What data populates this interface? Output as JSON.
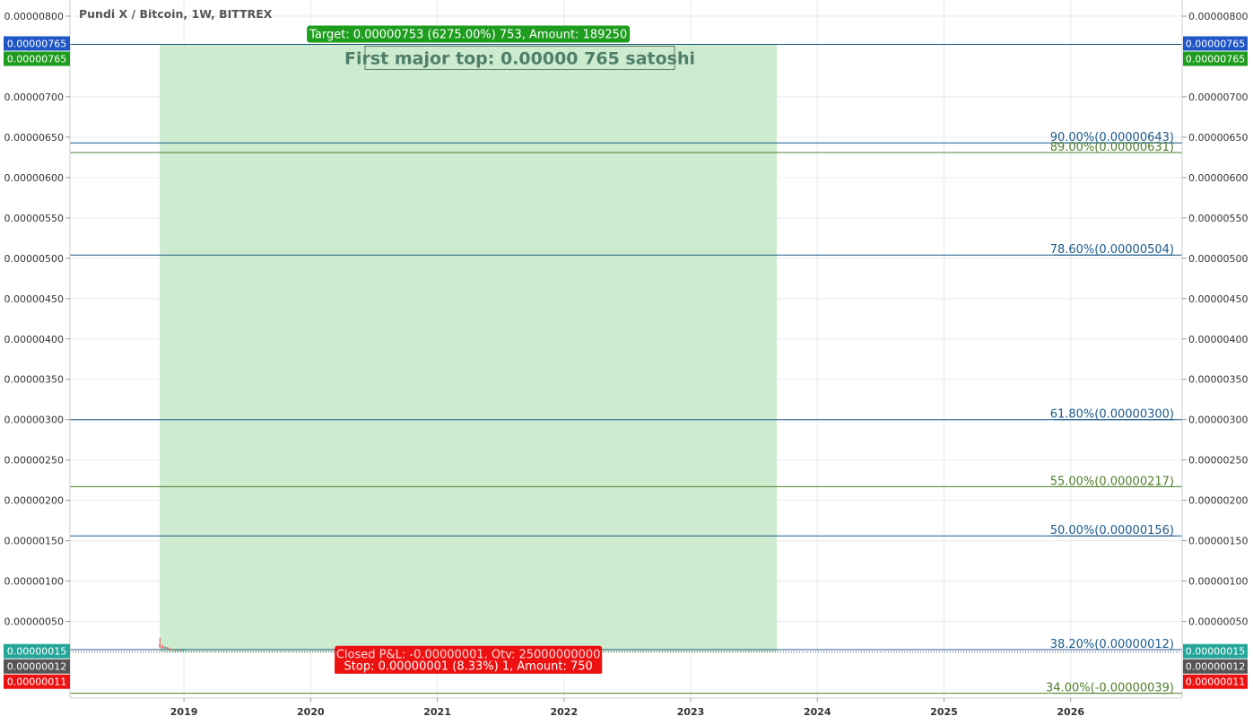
{
  "chart_data": {
    "type": "candlestick",
    "title": "Pundi X / Bitcoin, 1W, BITTREX",
    "ylim": [
      -4.5e-07,
      8.2e-06
    ],
    "xlim": [
      2018.1,
      2026.88
    ],
    "y_ticks": [
      {
        "value": 8e-06,
        "label": "0.00000800"
      },
      {
        "value": 7e-06,
        "label": "0.00000700"
      },
      {
        "value": 6.5e-06,
        "label": "0.00000650"
      },
      {
        "value": 6e-06,
        "label": "0.00000600"
      },
      {
        "value": 5.5e-06,
        "label": "0.00000550"
      },
      {
        "value": 5e-06,
        "label": "0.00000500"
      },
      {
        "value": 4.5e-06,
        "label": "0.00000450"
      },
      {
        "value": 4e-06,
        "label": "0.00000400"
      },
      {
        "value": 3.5e-06,
        "label": "0.00000350"
      },
      {
        "value": 3e-06,
        "label": "0.00000300"
      },
      {
        "value": 2.5e-06,
        "label": "0.00000250"
      },
      {
        "value": 2e-06,
        "label": "0.00000200"
      },
      {
        "value": 1.5e-06,
        "label": "0.00000150"
      },
      {
        "value": 1e-06,
        "label": "0.00000100"
      },
      {
        "value": 5e-07,
        "label": "0.00000050"
      }
    ],
    "x_ticks": [
      {
        "value": 2019,
        "label": "2019"
      },
      {
        "value": 2020,
        "label": "2020"
      },
      {
        "value": 2021,
        "label": "2021"
      },
      {
        "value": 2022,
        "label": "2022"
      },
      {
        "value": 2023,
        "label": "2023"
      },
      {
        "value": 2024,
        "label": "2024"
      },
      {
        "value": 2025,
        "label": "2025"
      },
      {
        "value": 2026,
        "label": "2026"
      }
    ],
    "candles": [
      {
        "x": 2018.81,
        "open": 2.1e-07,
        "close": 1.9e-07,
        "high": 3e-07,
        "low": 1.7e-07
      },
      {
        "x": 2018.83,
        "open": 1.9e-07,
        "close": 1.7e-07,
        "high": 2.1e-07,
        "low": 1.6e-07
      },
      {
        "x": 2018.85,
        "open": 1.7e-07,
        "close": 1.8e-07,
        "high": 1.9e-07,
        "low": 1.6e-07
      },
      {
        "x": 2018.87,
        "open": 1.8e-07,
        "close": 1.6e-07,
        "high": 1.8e-07,
        "low": 1.5e-07
      },
      {
        "x": 2018.89,
        "open": 1.6e-07,
        "close": 1.5e-07,
        "high": 1.7e-07,
        "low": 1.4e-07
      },
      {
        "x": 2018.91,
        "open": 1.5e-07,
        "close": 1.5e-07,
        "high": 1.6e-07,
        "low": 1.4e-07
      },
      {
        "x": 2018.93,
        "open": 1.5e-07,
        "close": 1.4e-07,
        "high": 1.5e-07,
        "low": 1.3e-07
      },
      {
        "x": 2018.95,
        "open": 1.4e-07,
        "close": 1.5e-07,
        "high": 1.6e-07,
        "low": 1.3e-07
      },
      {
        "x": 2018.97,
        "open": 1.5e-07,
        "close": 1.4e-07,
        "high": 1.5e-07,
        "low": 1.3e-07
      },
      {
        "x": 2018.99,
        "open": 1.4e-07,
        "close": 1.5e-07,
        "high": 1.6e-07,
        "low": 1.3e-07
      },
      {
        "x": 2019.01,
        "open": 1.5e-07,
        "close": 1.5e-07,
        "high": 1.6e-07,
        "low": 1.4e-07
      }
    ],
    "fib_levels": [
      {
        "label": "90.00%(0.00000643)",
        "value": 6.43e-06,
        "color": "#1c5a8c"
      },
      {
        "label": "89.00%(0.00000631)",
        "value": 6.31e-06,
        "color": "#4f7f2a"
      },
      {
        "label": "78.60%(0.00000504)",
        "value": 5.04e-06,
        "color": "#1c5a8c"
      },
      {
        "label": "61.80%(0.00000300)",
        "value": 3e-06,
        "color": "#1c5a8c"
      },
      {
        "label": "55.00%(0.00000217)",
        "value": 2.17e-06,
        "color": "#4f7f2a"
      },
      {
        "label": "50.00%(0.00000156)",
        "value": 1.56e-06,
        "color": "#1c5a8c"
      },
      {
        "label": "38.20%(0.00000012)",
        "value": 1.5e-07,
        "color": "#1c5a8c"
      },
      {
        "label": "34.00%(-0.00000039)",
        "value": -3.9e-07,
        "color": "#4f7f2a"
      }
    ],
    "top_line": {
      "value": 7.65e-06,
      "color": "#1c5a8c"
    },
    "position": {
      "x_start": 2018.81,
      "x_end": 2023.68,
      "entry": 1.2e-07,
      "target": 7.65e-06,
      "fill": "#cdebcf",
      "target_label": "Target: 0.00000753 (6275.00%) 753, Amount: 189250",
      "stop_label": "Stop: 0.00000001 (8.33%) 1, Amount: 750",
      "closed_label": "Closed P&L: -0.00000001, Qty: 25000000000"
    },
    "annotation": {
      "text": "First major top: 0.00000 765 satoshi",
      "x": 2020.3,
      "value": 7.65e-06
    },
    "price_tags": [
      {
        "side": "both",
        "value": 7.65e-06,
        "label": "0.00000765",
        "color": "#1e56c6",
        "offset": 0
      },
      {
        "side": "both",
        "value": 7.65e-06,
        "label": "0.00000765",
        "color": "#1e9d1e",
        "offset": 1
      },
      {
        "side": "both",
        "value": 1.5e-07,
        "label": "0.00000015",
        "color": "#26a69a",
        "offset": 0
      },
      {
        "side": "both",
        "value": 1.2e-07,
        "label": "0.00000012",
        "color": "#555555",
        "offset": 1
      },
      {
        "side": "left",
        "value": 1.2e-07,
        "label": "0.00000011",
        "color": "#ee1111",
        "offset": 2
      },
      {
        "side": "right",
        "value": 1.2e-07,
        "label": "0.00000011",
        "color": "#ee1111",
        "offset": 2
      }
    ],
    "colors": {
      "up": "#26a69a",
      "down": "#ef5350",
      "grid": "#e6eaee",
      "target_badge": "#1e9d1e",
      "stop_badge": "#ee1111",
      "annotation_text": "#4f7f6a",
      "annotation_border": "#5d7a6a"
    }
  }
}
